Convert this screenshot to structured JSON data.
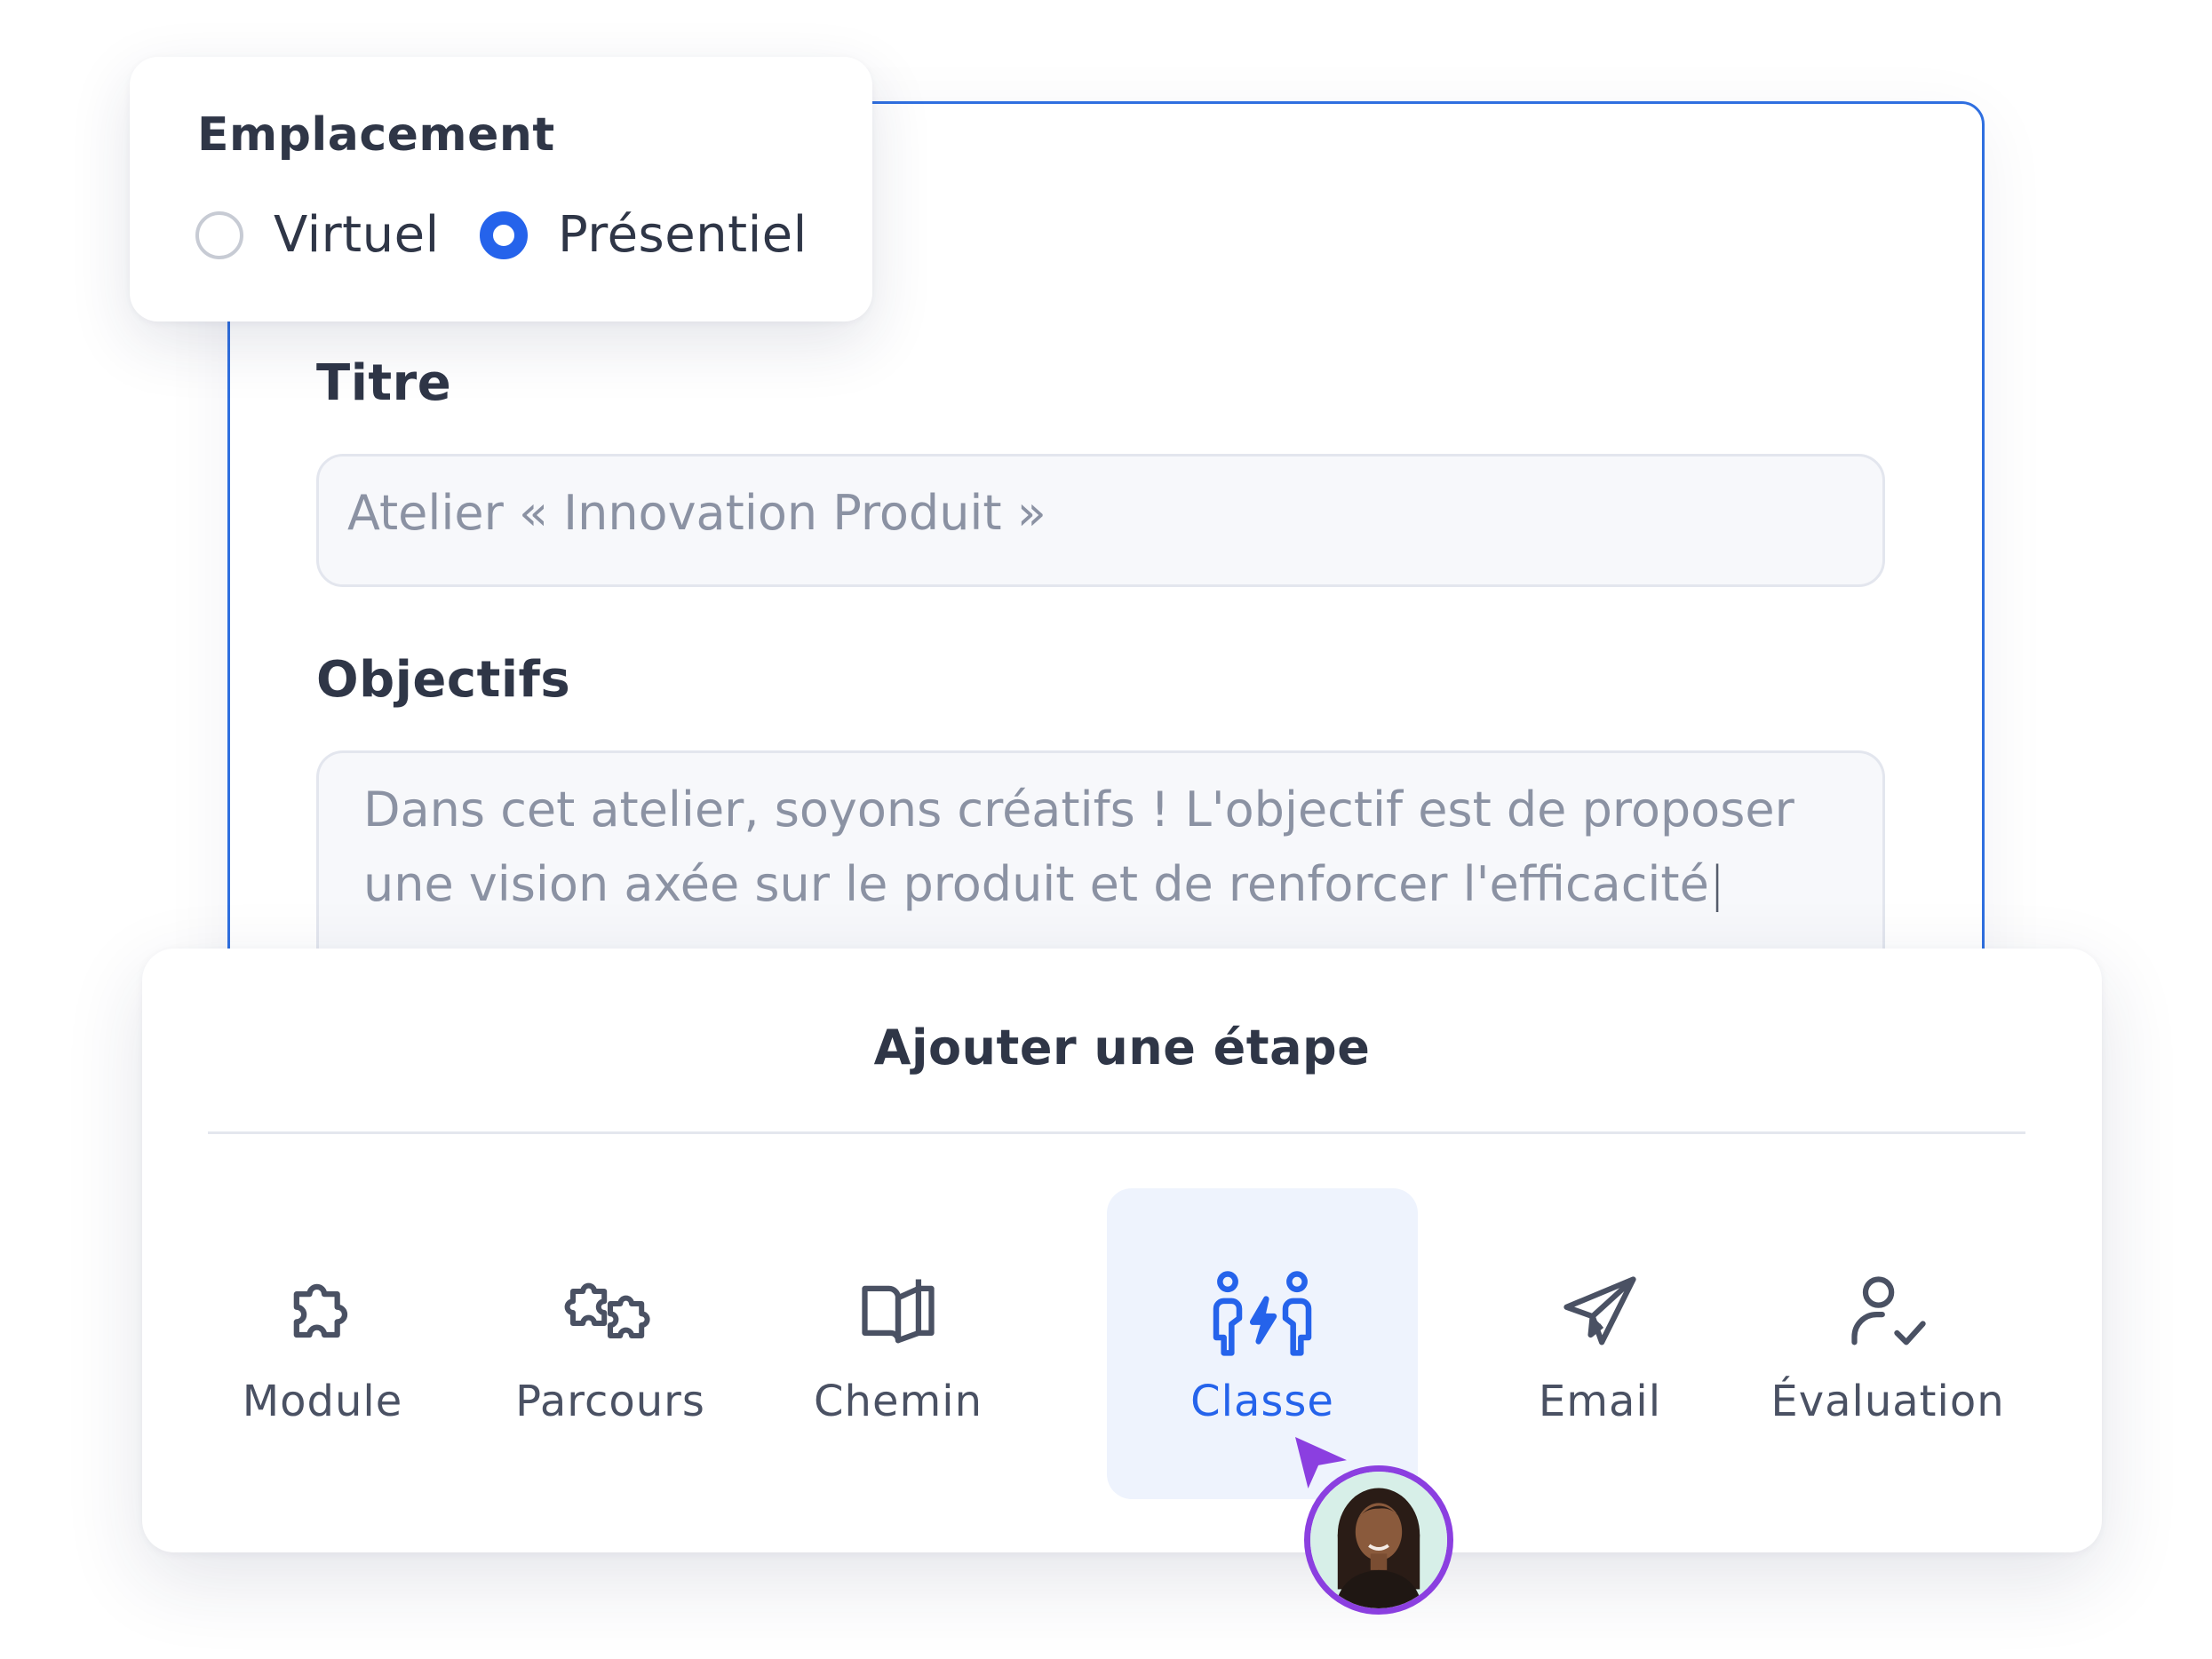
{
  "location": {
    "title": "Emplacement",
    "options": [
      {
        "label": "Virtuel",
        "selected": false
      },
      {
        "label": "Présentiel",
        "selected": true
      }
    ]
  },
  "form": {
    "title_label": "Titre",
    "title_value": "Atelier « Innovation Produit »",
    "objectives_label": "Objectifs",
    "objectives_line1": "Dans cet atelier, soyons créatifs ! L'objectif est de proposer",
    "objectives_line2": "une vision axée sur le produit et de renforcer l'efficacité",
    "caret": "|"
  },
  "steps": {
    "title": "Ajouter une étape",
    "items": [
      {
        "label": "Module",
        "icon": "puzzle-piece-icon"
      },
      {
        "label": "Parcours",
        "icon": "puzzle-pieces-icon"
      },
      {
        "label": "Chemin",
        "icon": "open-book-icon"
      },
      {
        "label": "Classe",
        "icon": "classroom-people-icon",
        "active": true
      },
      {
        "label": "Email",
        "icon": "paper-plane-icon"
      },
      {
        "label": "Évaluation",
        "icon": "user-check-icon"
      }
    ]
  },
  "colors": {
    "accent": "#2563eb",
    "cursor": "#8b3fe0",
    "active_bg": "#eef3fd"
  }
}
